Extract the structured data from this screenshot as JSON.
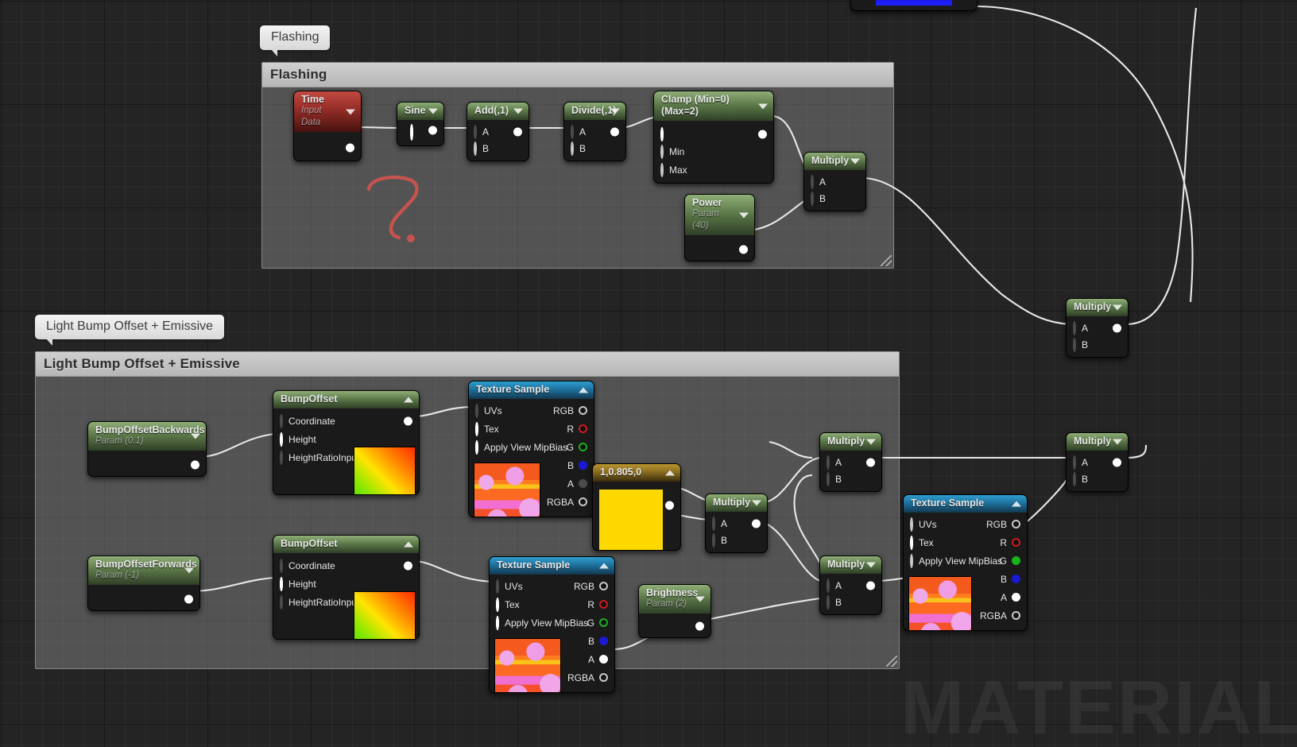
{
  "app": {
    "watermark": "MATERIAL",
    "canvas_name": "material-graph"
  },
  "comments": [
    {
      "bubble": "Flashing",
      "title": "Flashing"
    },
    {
      "bubble": "Light Bump Offset + Emissive",
      "title": "Light Bump Offset + Emissive"
    }
  ],
  "annotation": {
    "kind": "hand-drawn-question-mark",
    "color": "#e8231b"
  },
  "nodes": {
    "time": {
      "title": "Time",
      "subtitle": "Input Data"
    },
    "sine": {
      "title": "Sine"
    },
    "add": {
      "title": "Add(,1)",
      "a": "A",
      "b": "B"
    },
    "divide": {
      "title": "Divide(,1)",
      "a": "A",
      "b": "B"
    },
    "clamp": {
      "title": "Clamp (Min=0) (Max=2)",
      "min": "Min",
      "max": "Max"
    },
    "power": {
      "title": "Power",
      "subtitle": "Param (40)"
    },
    "multiply1": {
      "title": "Multiply",
      "a": "A",
      "b": "B"
    },
    "multiply_r1": {
      "title": "Multiply",
      "a": "A",
      "b": "B"
    },
    "multiply_r2": {
      "title": "Multiply",
      "a": "A",
      "b": "B"
    },
    "multiply_m1": {
      "title": "Multiply",
      "a": "A",
      "b": "B"
    },
    "multiply_m2": {
      "title": "Multiply",
      "a": "A",
      "b": "B"
    },
    "multiply_c": {
      "title": "Multiply",
      "a": "A",
      "b": "B"
    },
    "bumpback": {
      "title": "BumpOffsetBackwards",
      "subtitle": "Param (0.1)"
    },
    "bumpfwd": {
      "title": "BumpOffsetForwards",
      "subtitle": "Param (-1)"
    },
    "bumpoffset1": {
      "title": "BumpOffset",
      "coordinate": "Coordinate",
      "height": "Height",
      "ratio": "HeightRatioInput"
    },
    "bumpoffset2": {
      "title": "BumpOffset",
      "coordinate": "Coordinate",
      "height": "Height",
      "ratio": "HeightRatioInput"
    },
    "texture1": {
      "title": "Texture Sample"
    },
    "texture2": {
      "title": "Texture Sample"
    },
    "texture3": {
      "title": "Texture Sample"
    },
    "constant": {
      "title": "1,0.805,0",
      "color": "#ffd800"
    },
    "brightness": {
      "title": "Brightness",
      "subtitle": "Param (2)"
    }
  },
  "texture_pins": {
    "inputs": [
      "UVs",
      "Tex",
      "Apply View MipBias"
    ],
    "outputs": [
      "RGB",
      "R",
      "G",
      "B",
      "A",
      "RGBA"
    ]
  },
  "colors": {
    "wire": "#e8e8e8",
    "title_green": "#5d7a4a",
    "title_red": "#932c26",
    "title_blue": "#1d6e9a",
    "title_gold": "#8a6d20",
    "pin_r": "#d11b1b",
    "pin_g": "#19b319",
    "pin_b": "#1a1ad4"
  }
}
